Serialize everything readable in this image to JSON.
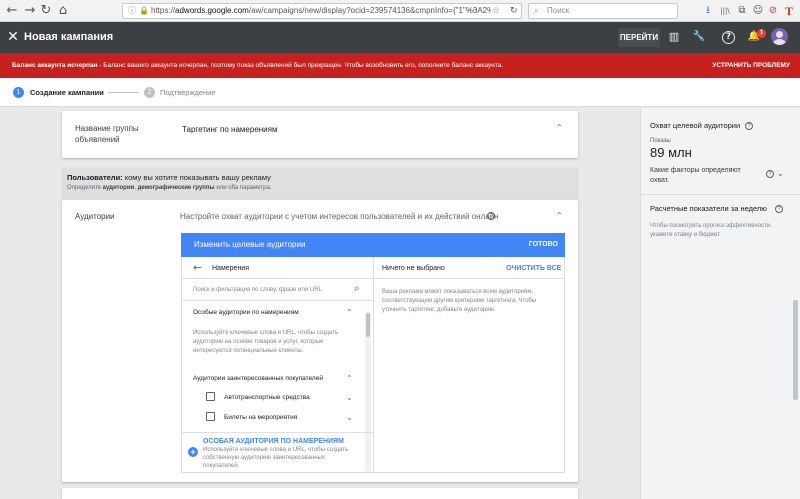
{
  "browser": {
    "url_domain": "adwords.google.com",
    "url_rest": "/aw/campaigns/new/display?ocid=239574136&cmpnInfo={\"1\"%3A2%",
    "url_prefix": "https://",
    "search_placeholder": "Поиск",
    "ellipsis": "···",
    "back": "←",
    "forward": "→",
    "reload": "↻",
    "home": "⌂",
    "lock": "ⓘ",
    "secure": "🔒",
    "bookmark": "☆",
    "refresh_small": "↻",
    "search_mag": "⌕",
    "icons": [
      "⭳",
      "|||\\",
      "⧉",
      "☺",
      "⊘",
      "T"
    ]
  },
  "header": {
    "close": "✕",
    "title": "Новая кампания",
    "go_button": "ПЕРЕЙТИ",
    "notifications_count": "1",
    "icons": {
      "reports": "▥",
      "tools": "🔧",
      "help": "?",
      "bell": "🔔"
    }
  },
  "alert": {
    "bold_text": "Баланс аккаунта исчерпан",
    "text": " - Баланс вашего аккаунта исчерпан, поэтому показ объявлений был прекращен. Чтобы возобновить его, пополните баланс аккаунта.",
    "action": "УСТРАНИТЬ ПРОБЛЕМУ",
    "color": "#c5221f"
  },
  "stepper": {
    "steps": [
      {
        "num": "1",
        "label": "Создание кампании",
        "active": true
      },
      {
        "num": "2",
        "label": "Подтверждение",
        "active": false
      }
    ]
  },
  "ad_group": {
    "label": "Название группы объявлений",
    "value": "Таргетинг по намерениям"
  },
  "users_section": {
    "title_bold": "Пользователи:",
    "title": " кому вы хотите показывать вашу рекламу",
    "sub_prefix": "Определите ",
    "sub_bold1": "аудитории",
    "sub_sep": ", ",
    "sub_bold2": "демографические группы",
    "sub_suffix": " или оба параметра."
  },
  "audiences": {
    "label": "Аудитории",
    "description": "Настройте охват аудитории с учетом интересов пользователей и их действий онлайн",
    "info": "?",
    "edit_title": "Изменить целевые аудитории",
    "done": "ГОТОВО",
    "back_arrow": "←",
    "nav_title": "Намерения",
    "search_placeholder": "Поиск и фильтрация по слову, фразе или URL",
    "custom_intent_title": "Особые аудитории по намерениям",
    "custom_intent_desc": [
      "Используйте ключевые слова и URL, чтобы создать",
      "аудиторию на основе товаров и услуг, которые",
      "интересуются потенциальные клиенты."
    ],
    "in_market_title": "Аудитории заинтересованных покупателей",
    "in_market_items": [
      "Автотранспортные средства",
      "Билеты на мероприятия"
    ],
    "new_custom_title": "ОСОБАЯ АУДИТОРИЯ ПО НАМЕРЕНИЯМ",
    "new_custom_desc": [
      "Используйте ключевые слова и URL, чтобы создать",
      "собственную аудиторию заинтересованных",
      "покупателей."
    ],
    "selected_title": "Ничего не выбрано",
    "clear_all": "ОЧИСТИТЬ ВСЕ",
    "selected_desc": [
      "Ваша реклама может показываться всем аудиториям,",
      "соответствующим другим критериям таргетинга. Чтобы",
      "уточнить таргетинг, добавьте аудиторию."
    ],
    "accent": "#4285f4"
  },
  "sidebar": {
    "reach_title": "Охват целевой аудитории",
    "impressions_label": "Показы",
    "impressions_value": "89 млн",
    "factors_question": [
      "Какие факторы определяют",
      "охват."
    ],
    "metrics_title": "Расчетные показатели за неделю",
    "metrics_desc": [
      "Чтобы посмотреть прогноз эффективности,",
      "укажите ставку и бюджет."
    ]
  }
}
